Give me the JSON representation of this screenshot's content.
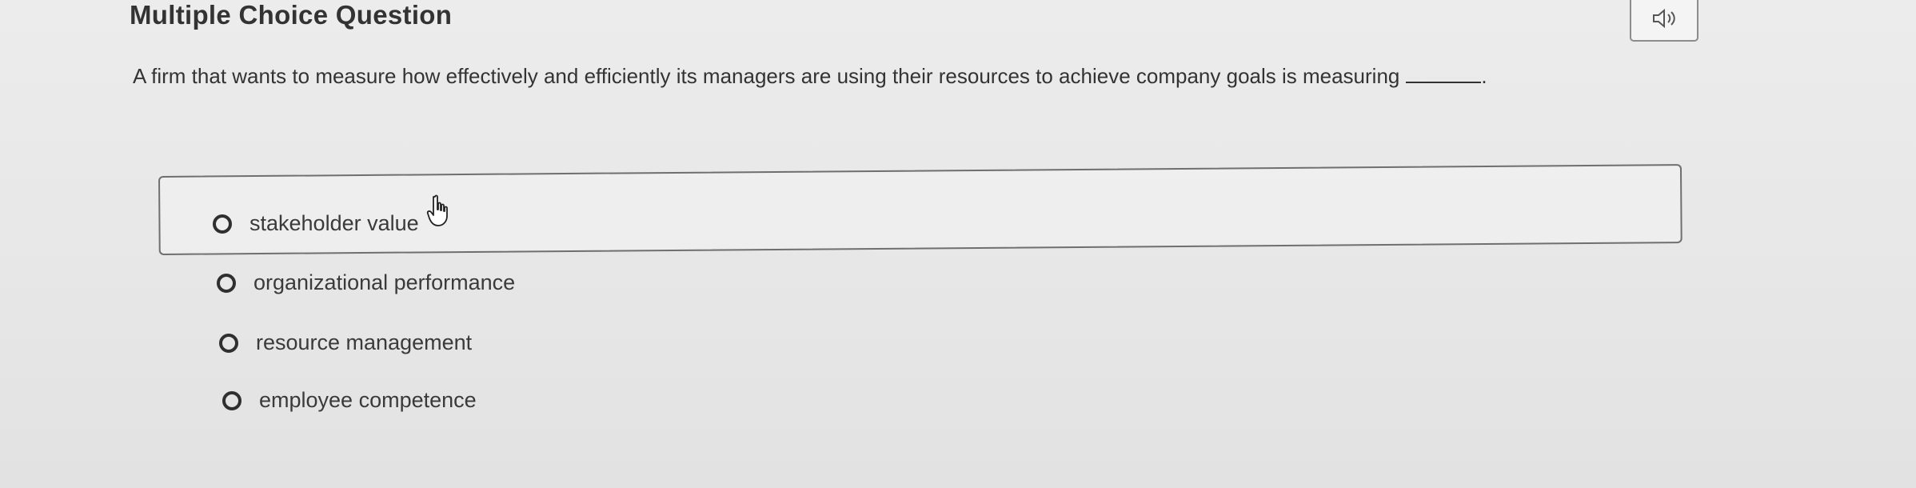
{
  "header": {
    "title": "Multiple Choice Question"
  },
  "question": {
    "text": "A firm that wants to measure how effectively and efficiently its managers are using their resources to achieve company goals is measuring",
    "blank_suffix": "."
  },
  "options": [
    {
      "label": "stakeholder value"
    },
    {
      "label": "organizational performance"
    },
    {
      "label": "resource management"
    },
    {
      "label": "employee competence"
    }
  ],
  "audio": {
    "icon": "speaker-icon"
  },
  "cursor": {
    "icon": "hand-pointer-icon"
  }
}
